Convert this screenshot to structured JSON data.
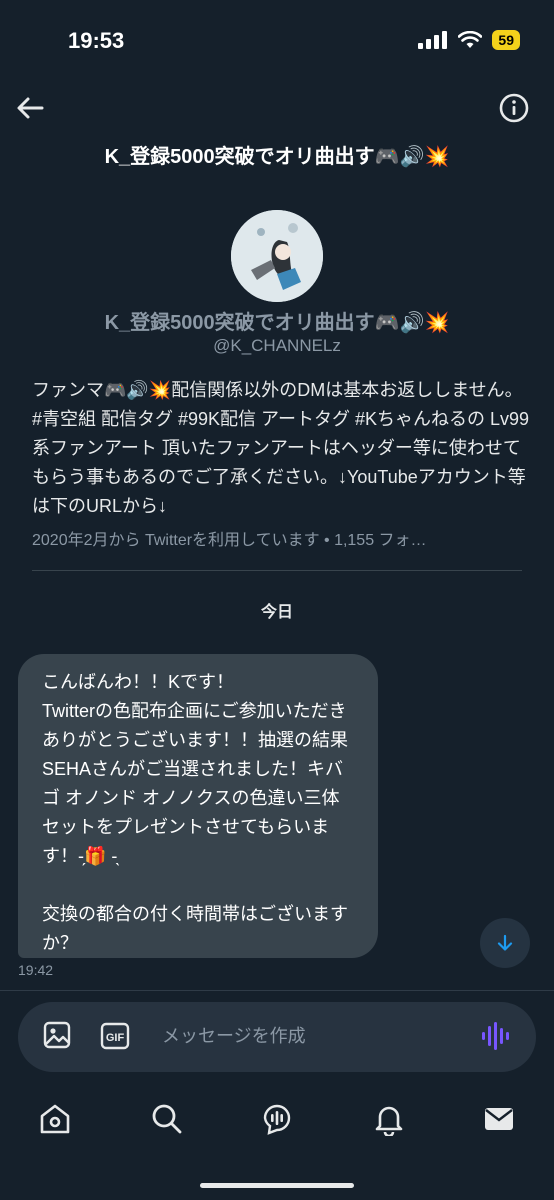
{
  "status_bar": {
    "time": "19:53",
    "battery": "59"
  },
  "header": {
    "title": "K_登録5000突破でオリ曲出す🎮🔊💥"
  },
  "profile": {
    "name": "K_登録5000突破でオリ曲出す🎮🔊💥",
    "handle": "@K_CHANNELz",
    "bio": "ファンマ🎮🔊💥配信関係以外のDMは基本お返ししません。#青空組 配信タグ #99K配信 アートタグ #Kちゃんねるの Lv99系ファンアート 頂いたファンアートはヘッダー等に使わせてもらう事もあるのでご了承ください。↓YouTubeアカウント等は下のURLから↓",
    "meta": "2020年2月から Twitterを利用しています • 1,155 フォ…"
  },
  "conversation": {
    "date_label": "今日",
    "messages": [
      {
        "text": "こんばんわ！！Kです！\nTwitterの色配布企画にご参加いただきありがとうございます！！抽選の結果SEHAさんがご当選されました！キバゴ オノンド オノノクスの色違い三体セットをプレゼントさせてもらいます！-̗🎁 -̖\n\n交換の都合の付く時間帯はございますか？",
        "time": "19:42"
      }
    ]
  },
  "composer": {
    "placeholder": "メッセージを作成",
    "gif_label": "GIF"
  },
  "nav": {
    "items": [
      "home",
      "search",
      "spaces",
      "notifications",
      "messages"
    ]
  },
  "colors": {
    "background": "#15202b",
    "bubble": "#38444d",
    "accent": "#1d9bf0",
    "voice": "#7856ff"
  }
}
